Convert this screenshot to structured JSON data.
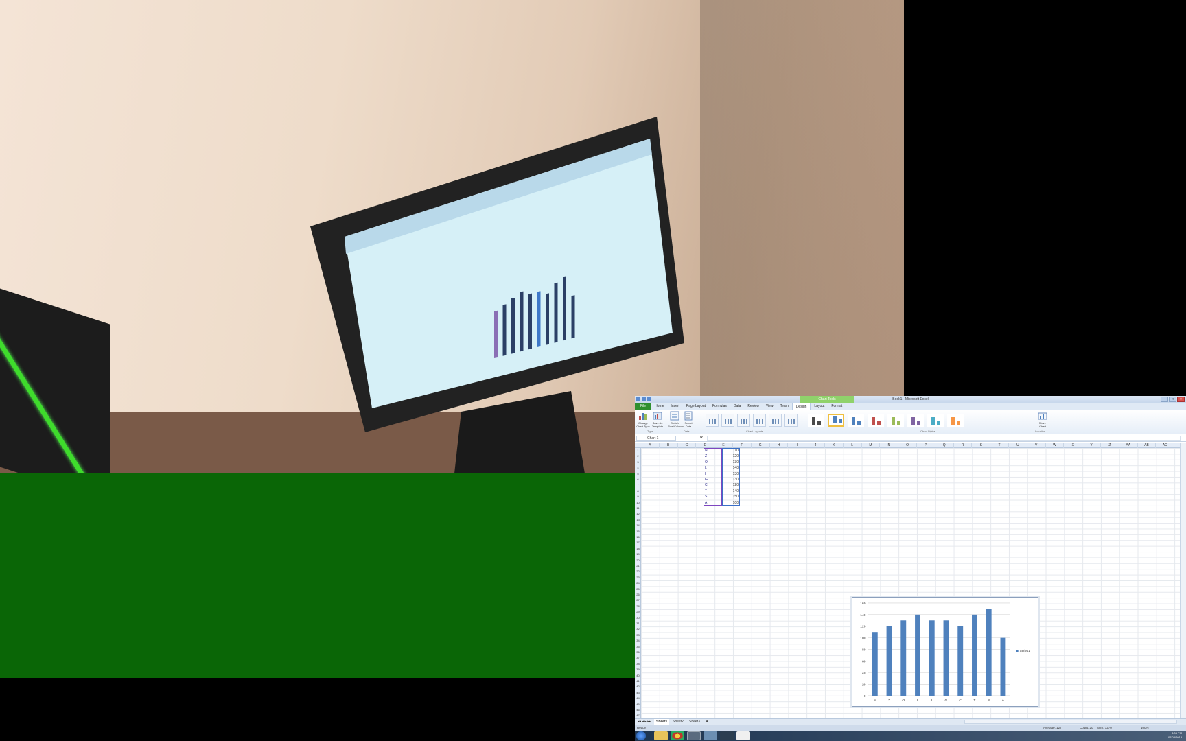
{
  "excel": {
    "window_title": "Book1 - Microsoft Excel",
    "contextual_tab_group": "Chart Tools",
    "tabs": [
      "File",
      "Home",
      "Insert",
      "Page Layout",
      "Formulas",
      "Data",
      "Review",
      "View",
      "Team",
      "Design",
      "Layout",
      "Format"
    ],
    "active_tab": "Design",
    "ribbon": {
      "buttons": [
        {
          "label": "Change Chart Type"
        },
        {
          "label": "Save As Template"
        },
        {
          "label": "Switch Row/Column"
        },
        {
          "label": "Select Data"
        },
        {
          "label": "Move Chart"
        }
      ],
      "groups": [
        "Type",
        "Data",
        "Chart Layouts",
        "Chart Styles",
        "Location"
      ],
      "style_colors": [
        "#4a4a4a",
        "#4f81bd",
        "#4f81bd",
        "#c0504d",
        "#9bbb59",
        "#8064a2",
        "#4bacc6",
        "#f79646"
      ]
    },
    "name_box": "Chart 1",
    "fx_label": "fx",
    "columns": [
      "A",
      "B",
      "C",
      "D",
      "E",
      "F",
      "G",
      "H",
      "I",
      "J",
      "K",
      "L",
      "M",
      "N",
      "O",
      "P",
      "Q",
      "R",
      "S",
      "T",
      "U",
      "V",
      "W",
      "X",
      "Y",
      "Z",
      "AA",
      "AB",
      "AC"
    ],
    "rows": [
      "1",
      "2",
      "3",
      "4",
      "5",
      "6",
      "7",
      "8",
      "9",
      "10",
      "11",
      "12",
      "13",
      "14",
      "15",
      "16",
      "17",
      "18",
      "19",
      "20",
      "21",
      "22",
      "23",
      "24",
      "25",
      "26",
      "27",
      "28",
      "29",
      "30",
      "31",
      "32",
      "33",
      "34",
      "35",
      "36",
      "37",
      "38",
      "39",
      "40",
      "41",
      "42",
      "43",
      "44",
      "45",
      "46",
      "47"
    ],
    "cells": [
      {
        "letter": "N",
        "value": "110"
      },
      {
        "letter": "Z",
        "value": "120"
      },
      {
        "letter": "O",
        "value": "130"
      },
      {
        "letter": "L",
        "value": "140"
      },
      {
        "letter": "I",
        "value": "130"
      },
      {
        "letter": "G",
        "value": "130"
      },
      {
        "letter": "C",
        "value": "120"
      },
      {
        "letter": "T",
        "value": "140"
      },
      {
        "letter": "S",
        "value": "150"
      },
      {
        "letter": "A",
        "value": "100"
      }
    ],
    "sheets": [
      "Sheet1",
      "Sheet2",
      "Sheet3"
    ],
    "status": {
      "ready": "Ready",
      "average": "Average: 127",
      "count": "Count: 20",
      "sum": "Sum: 1270",
      "zoom": "100%"
    },
    "clock": {
      "time": "3:03 PM",
      "date": "07/08/2013"
    }
  },
  "chart_data": {
    "type": "bar",
    "categories": [
      "N",
      "Z",
      "O",
      "L",
      "I",
      "G",
      "C",
      "T",
      "S",
      "A"
    ],
    "series": [
      {
        "name": "Series1",
        "values": [
          110,
          120,
          130,
          140,
          130,
          130,
          120,
          140,
          150,
          100
        ]
      }
    ],
    "ylim": [
      0,
      160
    ],
    "yticks": [
      0,
      20,
      40,
      60,
      80,
      100,
      120,
      140,
      160
    ],
    "grid": true,
    "legend": "right",
    "color": "#4f81bd"
  }
}
